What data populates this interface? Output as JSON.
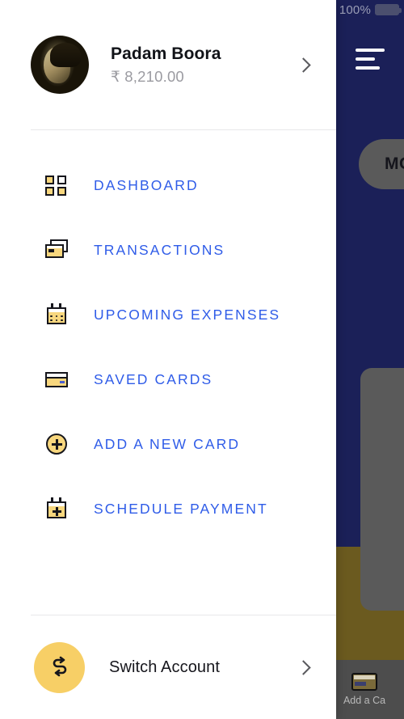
{
  "background_app": {
    "status_bar": {
      "battery_percent": "100%",
      "battery_icon": "battery-icon"
    },
    "menu_icon": "hamburger-menu-icon",
    "pill_label": "MO",
    "bottom_bar": {
      "item_label": "Add a Ca",
      "item_icon": "credit-card-icon"
    }
  },
  "drawer": {
    "profile": {
      "avatar_icon": "user-avatar",
      "name": "Padam Boora",
      "balance": "₹ 8,210.00",
      "chevron_icon": "chevron-right-icon"
    },
    "nav_items": [
      {
        "label": "DASHBOARD",
        "icon": "grid-icon"
      },
      {
        "label": "TRANSACTIONS",
        "icon": "stacked-cards-icon"
      },
      {
        "label": "UPCOMING EXPENSES",
        "icon": "calendar-dots-icon"
      },
      {
        "label": "SAVED CARDS",
        "icon": "credit-card-icon"
      },
      {
        "label": "ADD A NEW CARD",
        "icon": "plus-circle-icon"
      },
      {
        "label": "SCHEDULE PAYMENT",
        "icon": "calendar-plus-icon"
      }
    ],
    "switch_account": {
      "label": "Switch Account",
      "icon": "switch-arrows-icon",
      "chevron_icon": "chevron-right-icon"
    }
  },
  "colors": {
    "accent_blue": "#2f5ce8",
    "accent_yellow": "#f8d77e",
    "switch_yellow": "#f7cf66",
    "navy_background": "#1b2058",
    "olive": "#6b5a1f",
    "text_dark": "#16161c",
    "text_muted": "#9b9ba1"
  }
}
